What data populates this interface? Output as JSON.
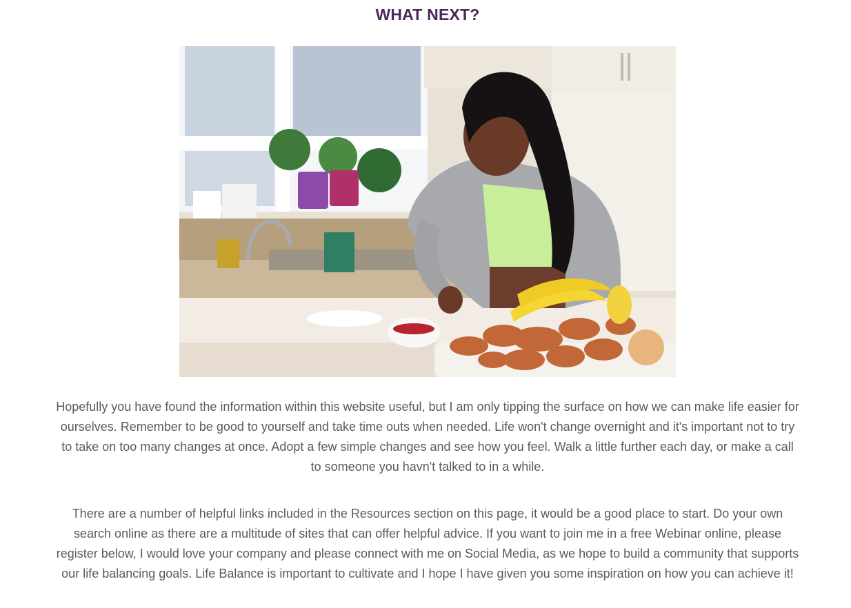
{
  "section": {
    "heading": "WHAT NEXT?",
    "image_alt": "Woman preparing fruit and vegetables in a kitchen",
    "paragraphs": [
      "Hopefully you have found the information within this website useful, but I am only tipping the surface on how we can make life easier for ourselves. Remember to be good to yourself and take time outs when needed. Life won't change overnight and it's important not to try to take on too many changes at once. Adopt a few simple changes and see how you feel. Walk a little further each day, or make a call to someone you havn't talked to in a while.",
      "There are a number of helpful links included in the Resources section on this page, it would be a good place to start. Do your own search online as there are a multitude of sites that can offer helpful advice. If you want to join me in a free Webinar online, please register below, I would love your company and please connect with me on Social Media, as we hope to build a community that supports our life balancing goals. Life Balance is important to cultivate and I hope I have given you some inspiration on how you can achieve it!"
    ]
  },
  "colors": {
    "heading": "#4b2757",
    "body_text": "#5a5a5a",
    "background": "#ffffff"
  }
}
